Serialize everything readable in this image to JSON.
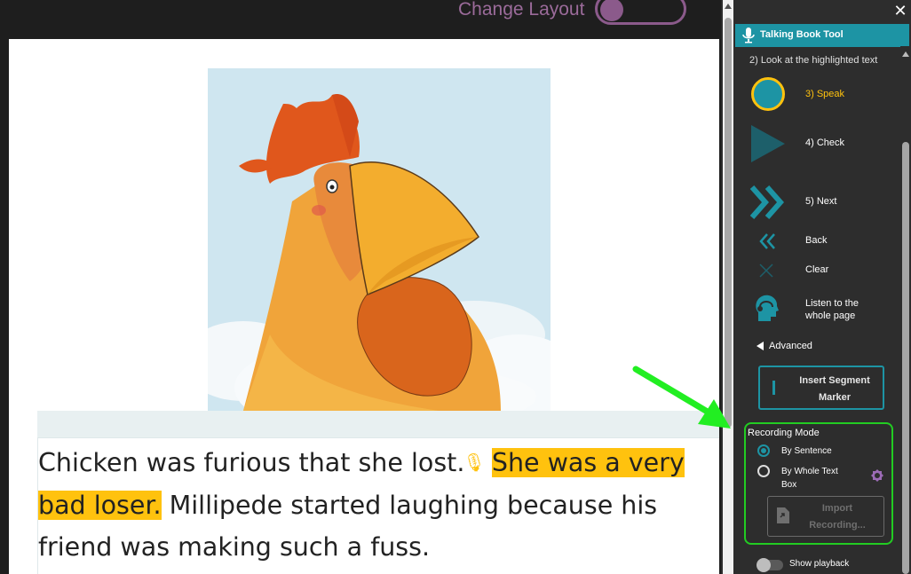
{
  "top_bar": {
    "change_layout_label": "Change Layout",
    "change_layout_enabled": true
  },
  "page": {
    "picture_alt": "Rooster illustration",
    "sentence_1": "Chicken was furious that she lost.",
    "sentence_2": "She was a very bad loser.",
    "sentence_3": "Millipede started laughing because his friend was making such a fuss.",
    "highlighted_sentence": 2
  },
  "panel": {
    "close_label": "✕",
    "tool_title": "Talking Book Tool",
    "steps": {
      "look": "2) Look at the highlighted text",
      "speak": "3) Speak",
      "check": "4) Check",
      "next": "5) Next",
      "back": "Back",
      "clear": "Clear",
      "listen": "Listen to the whole page"
    },
    "advanced": {
      "toggle_label": "Advanced",
      "insert_segment_label": "Insert Segment Marker"
    },
    "recording_mode": {
      "title": "Recording Mode",
      "options": [
        "By Sentence",
        "By Whole Text Box"
      ],
      "selected": "By Sentence",
      "import_label": "Import Recording..."
    },
    "show_playback": {
      "label": "Show playback",
      "enabled": false
    }
  },
  "colors": {
    "accent": "#1d94a4",
    "highlight": "#ffc20e",
    "annotation_green": "#22cc22",
    "layout_purple": "#8b5a8b"
  }
}
